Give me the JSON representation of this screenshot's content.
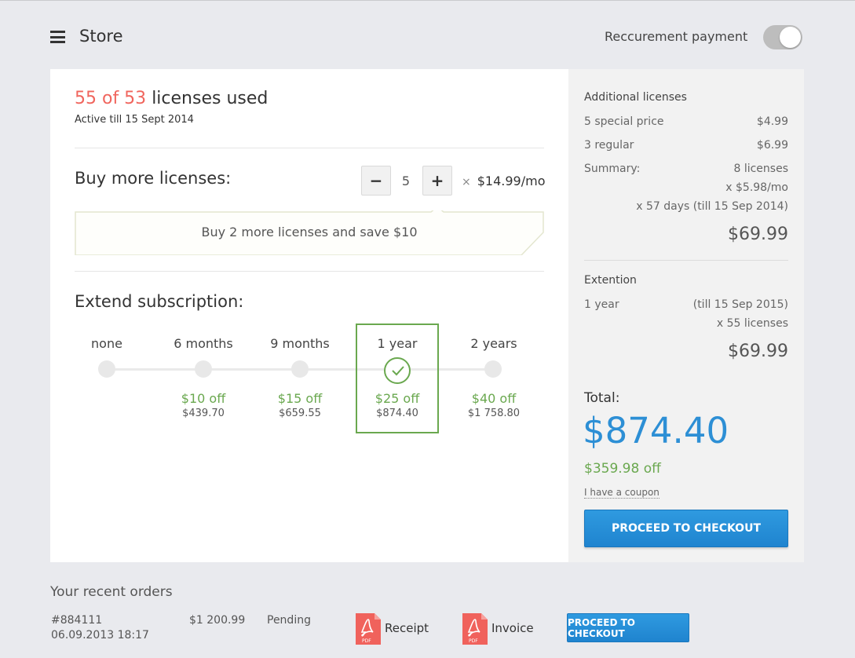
{
  "header": {
    "title": "Store",
    "recurrent_label": "Reccurement payment",
    "recurrent_on": true
  },
  "licenses": {
    "used": "55 of 53",
    "used_suffix": "licenses used",
    "active_till": "Active till 15 Sept 2014"
  },
  "buy": {
    "title": "Buy more licenses:",
    "minus": "−",
    "plus": "+",
    "quantity": "5",
    "times": "×",
    "price": "$14.99/mo",
    "promo": "Buy 2 more licenses and save $10"
  },
  "extend": {
    "title": "Extend subscription:",
    "options": [
      {
        "label": "none",
        "off": "",
        "price": ""
      },
      {
        "label": "6 months",
        "off": "$10 off",
        "price": "$439.70"
      },
      {
        "label": "9 months",
        "off": "$15 off",
        "price": "$659.55"
      },
      {
        "label": "1 year",
        "off": "$25 off",
        "price": "$874.40"
      },
      {
        "label": "2 years",
        "off": "$40 off",
        "price": "$1 758.80"
      }
    ],
    "selected_index": 3
  },
  "summary": {
    "additional_title": "Additional licenses",
    "special_label": "5 special price",
    "special_price": "$4.99",
    "regular_label": "3 regular",
    "regular_price": "$6.99",
    "summary_label": "Summary:",
    "summary_licenses": "8 licenses",
    "summary_rate": "x $5.98/mo",
    "summary_days": "x 57 days (till 15 Sep 2014)",
    "additional_total": "$69.99",
    "extension_title": "Extention",
    "extension_term": "1 year",
    "extension_till": "(till 15 Sep 2015)",
    "extension_licenses": "x 55 licenses",
    "extension_total": "$69.99",
    "total_label": "Total:",
    "total_amount": "$874.40",
    "total_off": "$359.98 off",
    "coupon": "I have a coupon",
    "checkout": "PROCEED TO CHECKOUT"
  },
  "orders": {
    "title": "Your recent orders",
    "items": [
      {
        "id": "#884111",
        "date": "06.09.2013 18:17",
        "amount": "$1 200.99",
        "status": "Pending",
        "pdf_tag": "PDF",
        "receipt": "Receipt",
        "invoice": "Invoice",
        "checkout": "PROCEED TO CHECKOUT"
      }
    ]
  },
  "colors": {
    "accent_blue": "#2d8fd5",
    "green": "#6aa84f",
    "red": "#f0655d",
    "pdf_red": "#f0625c"
  }
}
